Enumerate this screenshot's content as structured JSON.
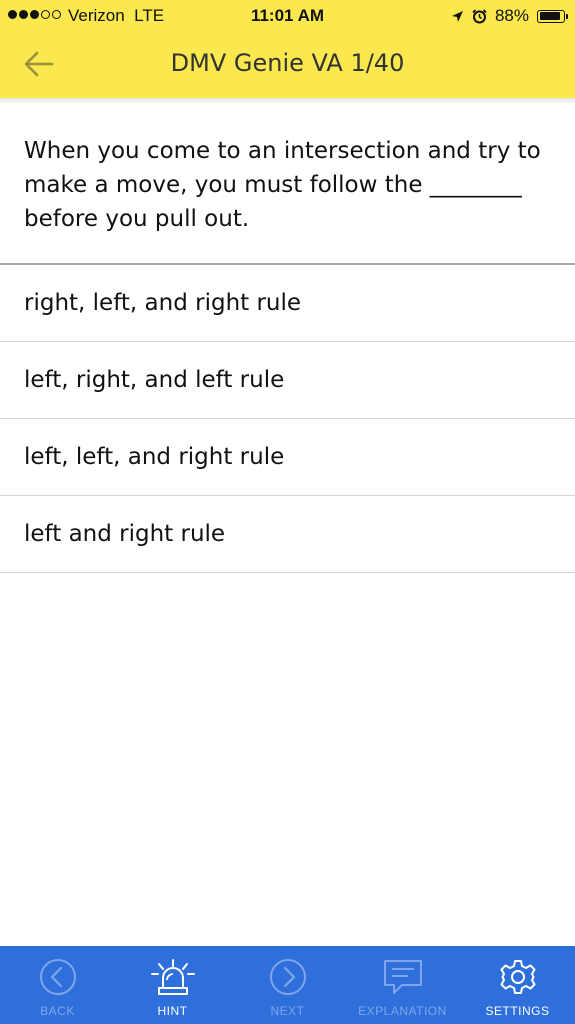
{
  "status_bar": {
    "carrier": "Verizon  LTE",
    "time": "11:01 AM",
    "battery_percent": "88%",
    "battery_level": 0.88,
    "signal_bars_filled": 3,
    "signal_bars_total": 5
  },
  "header": {
    "title": "DMV Genie VA 1/40",
    "back_icon": "back-arrow-icon"
  },
  "question": {
    "text": "When you come to an intersection and try to make a move, you must follow the ________ before you pull out."
  },
  "answers": [
    {
      "label": "right, left, and right rule"
    },
    {
      "label": "left, right, and left rule"
    },
    {
      "label": "left, left, and right rule"
    },
    {
      "label": "left and right rule"
    }
  ],
  "tab_bar": {
    "back": {
      "label": "BACK",
      "icon": "chevron-left-circle-icon"
    },
    "hint": {
      "label": "HINT",
      "icon": "siren-icon"
    },
    "next": {
      "label": "NEXT",
      "icon": "chevron-right-circle-icon"
    },
    "explanation": {
      "label": "EXPLANATION",
      "icon": "speech-bubble-icon"
    },
    "settings": {
      "label": "SETTINGS",
      "icon": "gear-icon"
    }
  },
  "colors": {
    "header_bg": "#fbe84e",
    "tab_bar_bg": "#2f6fdc",
    "disabled_tab": "#7fa6ea",
    "enabled_tab": "#ffffff"
  }
}
